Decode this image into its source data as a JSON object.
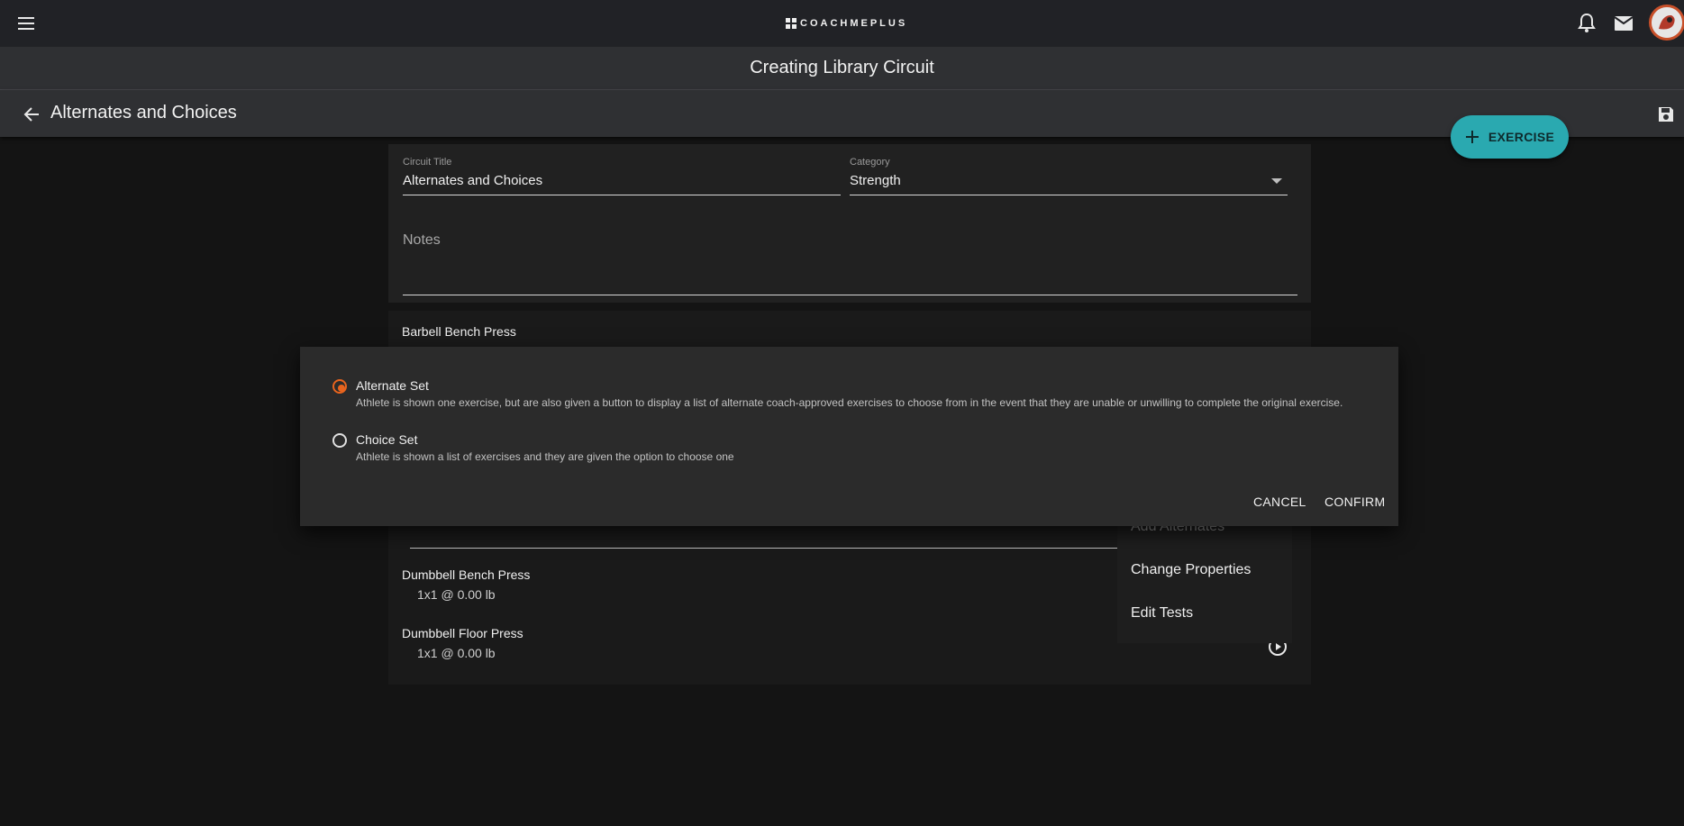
{
  "topbar": {
    "logo_text": "COACHMEPLUS",
    "icons": [
      "menu-icon",
      "bell-icon",
      "mail-icon",
      "avatar"
    ]
  },
  "subheader": {
    "title": "Creating Library Circuit"
  },
  "toolbar": {
    "title": "Alternates and Choices",
    "icons": [
      "arrow-back-icon",
      "save-icon"
    ]
  },
  "fab": {
    "label": "EXERCISE",
    "icon": "plus-icon",
    "color": "#2aa9b0"
  },
  "form": {
    "circuit_title_label": "Circuit Title",
    "circuit_title_value": "Alternates and Choices",
    "category_label": "Category",
    "category_value": "Strength",
    "notes_label": "Notes"
  },
  "exercises": [
    {
      "name": "Barbell Bench Press"
    },
    {
      "name": "Dumbbell Bench Press",
      "detail": "1x1  @ 0.00 lb"
    },
    {
      "name": "Dumbbell Floor Press",
      "detail": "1x1  @ 0.00 lb"
    }
  ],
  "context_menu": {
    "items": [
      "Add Alternates",
      "Change Properties",
      "Edit Tests"
    ]
  },
  "dialog": {
    "options": [
      {
        "title": "Alternate Set",
        "description": "Athlete is shown one exercise, but are also given a button to display a list of alternate coach-approved exercises to choose from in the event that they are unable or unwilling to complete the original exercise.",
        "selected": true
      },
      {
        "title": "Choice Set",
        "description": "Athlete is shown a list of exercises and they are given the option to choose one",
        "selected": false
      }
    ],
    "cancel_label": "CANCEL",
    "confirm_label": "CONFIRM"
  },
  "colors": {
    "accent": "#e8641e",
    "teal": "#2aa9b0",
    "background": "#141414"
  }
}
